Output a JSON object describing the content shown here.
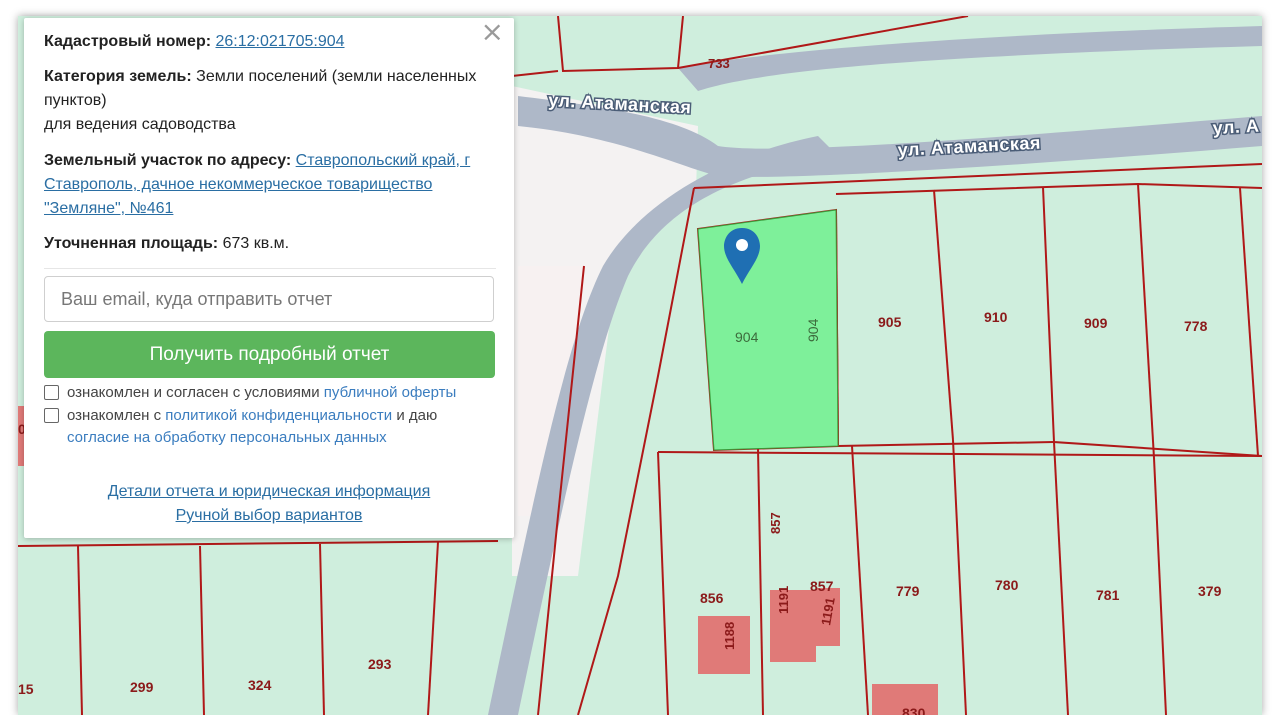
{
  "map": {
    "streets": [
      "ул. Атаманская",
      "ул. Атаманская",
      "ул. А"
    ],
    "parcels": [
      "733",
      "904",
      "904",
      "905",
      "910",
      "909",
      "778",
      "856",
      "857",
      "857",
      "1188",
      "1191",
      "1191",
      "779",
      "780",
      "781",
      "379",
      "299",
      "324",
      "293",
      "15",
      "830",
      "0"
    ],
    "selected_parcel_color": "#7ef09a",
    "parcel_border_color": "#b01818",
    "road_color": "#a9b6c8",
    "marker_color": "#1f6fb3"
  },
  "panel": {
    "close_symbol": "×",
    "cadastral_label": "Кадастровый номер:",
    "cadastral_value": "26:12:021705:904",
    "category_label": "Категория земель:",
    "category_value": "Земли поселений (земли населенных пунктов)",
    "category_use": "для ведения садоводства",
    "address_label": "Земельный участок по адресу:",
    "address_value": "Ставропольский край, г Ставрополь, дачное некоммерческое товарищество \"Земляне\", №461",
    "area_label": "Уточненная площадь:",
    "area_value": "673 кв.м.",
    "email_placeholder": "Ваш email, куда отправить отчет",
    "submit_label": "Получить подробный отчет",
    "consent1_text": "ознакомлен и согласен с условиями",
    "consent1_link": "публичной оферты",
    "consent2_text_a": "ознакомлен с",
    "consent2_link_a": "политикой конфиденциальности",
    "consent2_text_b": "и даю",
    "consent2_link_b": "согласие на обработку персональных данных",
    "details_link": "Детали отчета и юридическая информация",
    "manual_link": "Ручной выбор вариантов"
  }
}
